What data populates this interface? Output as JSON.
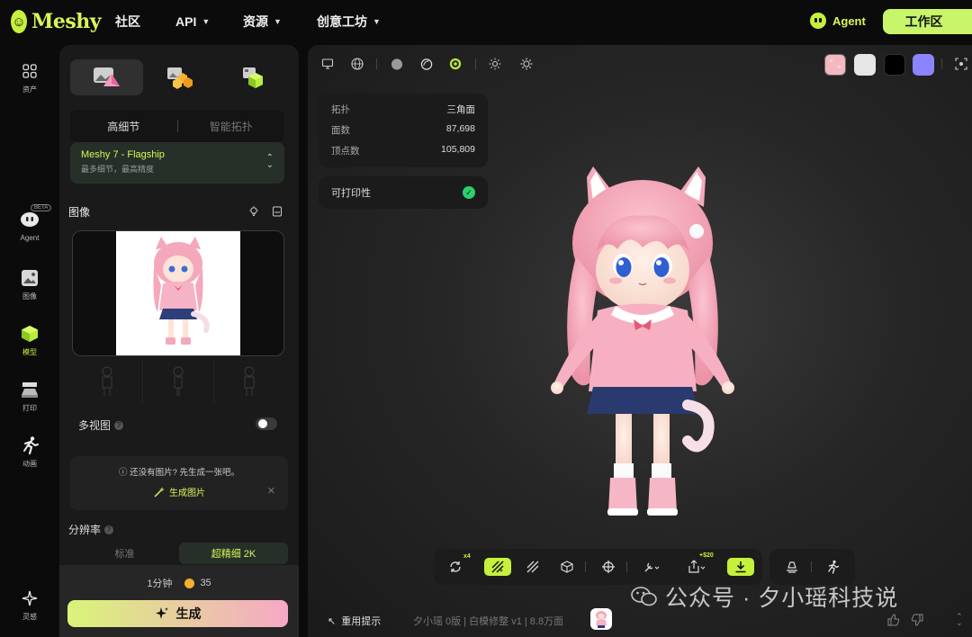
{
  "app": {
    "logo": "Meshy"
  },
  "nav": {
    "items": [
      {
        "label": "社区",
        "dropdown": false
      },
      {
        "label": "API",
        "dropdown": true
      },
      {
        "label": "资源",
        "dropdown": true
      },
      {
        "label": "创意工坊",
        "dropdown": true
      }
    ],
    "agent_label": "Agent",
    "workspace_label": "工作区"
  },
  "rail": {
    "assets": "资产",
    "agent": "Agent",
    "agent_badge": "BETA",
    "image": "图像",
    "model": "模型",
    "print": "打印",
    "animate": "动画",
    "inspire": "灵感"
  },
  "panel": {
    "subtabs": [
      "高细节",
      "智能拓扑"
    ],
    "model": {
      "name": "Meshy 7 - Flagship",
      "desc": "最多细节，最高精度"
    },
    "image_title": "图像",
    "multiview_label": "多视图",
    "tip": {
      "question": "还没有图片? 先生成一张吧。",
      "action": "生成图片"
    },
    "resolution_title": "分辨率",
    "resolution_options": [
      "标准",
      "超精细 2K"
    ],
    "time": "1分钟",
    "credits": "35",
    "generate_label": "生成"
  },
  "viewport": {
    "stats": [
      {
        "key": "拓扑",
        "value": "三角面"
      },
      {
        "key": "面数",
        "value": "87,698"
      },
      {
        "key": "顶点数",
        "value": "105,809"
      }
    ],
    "printable_label": "可打印性",
    "swatch_colors": [
      "#f4b8c0",
      "#e6e6e6",
      "#000000",
      "#8c84ff"
    ],
    "toolbar": {
      "count_badge": "x4",
      "price_badge": "+$20"
    },
    "footer": {
      "reuse_label": "重用提示",
      "breadcrumb": "夕小瑶 0版 | 白模修整 v1 | 8.8万面"
    },
    "watermark": "公众号 · 夕小瑶科技说"
  },
  "colors": {
    "accent": "#c5f03c",
    "success": "#2bd06a"
  }
}
